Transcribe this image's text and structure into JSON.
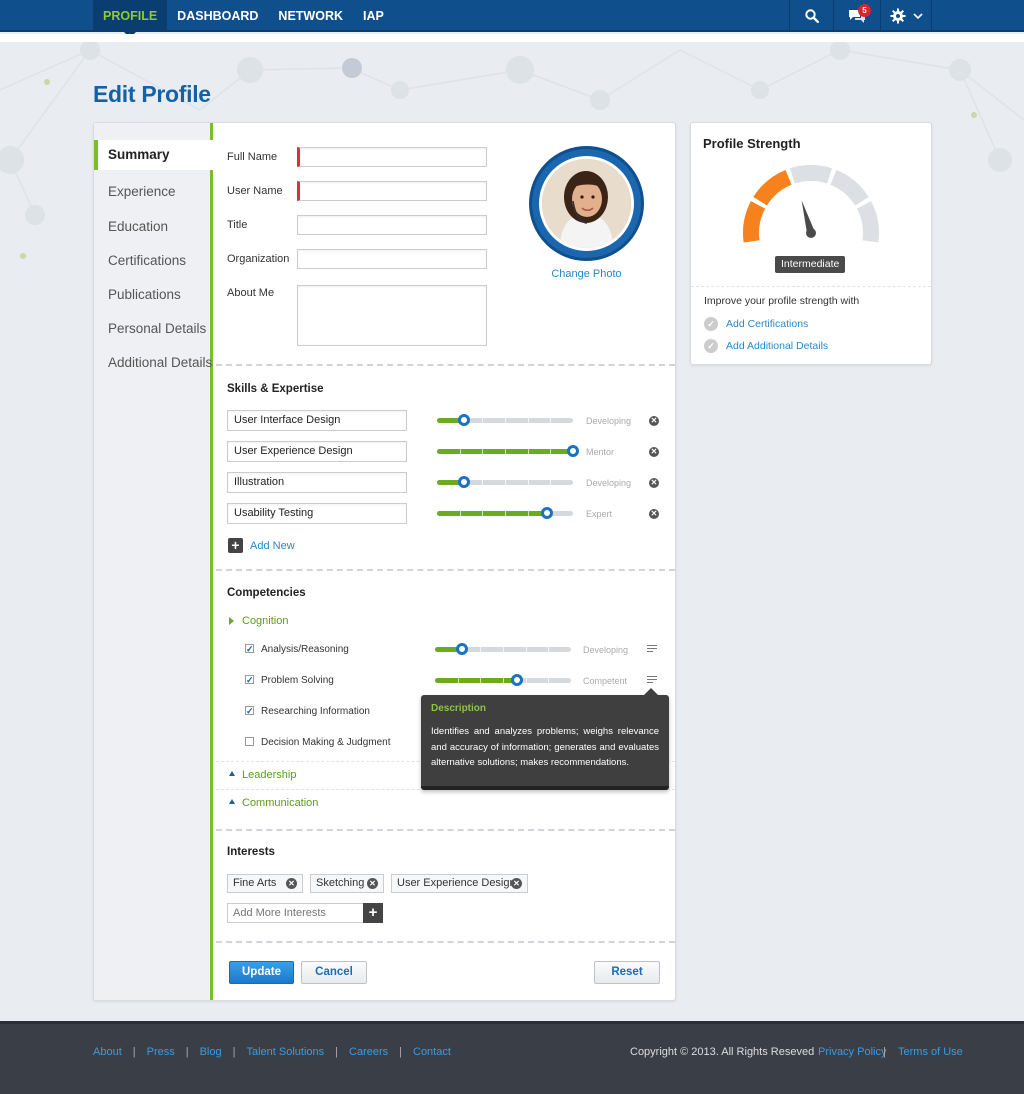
{
  "nav": {
    "items": [
      {
        "label": "PROFILE",
        "active": true
      },
      {
        "label": "DASHBOARD",
        "active": false
      },
      {
        "label": "NETWORK",
        "active": false
      },
      {
        "label": "IAP",
        "active": false
      }
    ],
    "tools": {
      "search_icon": "search-icon",
      "chat_icon": "chat-icon",
      "chat_badge": "5",
      "gear_icon": "gear-icon"
    }
  },
  "page": {
    "title": "Edit Profile"
  },
  "sidenav": {
    "items": [
      {
        "label": "Summary",
        "active": true
      },
      {
        "label": "Experience"
      },
      {
        "label": "Education"
      },
      {
        "label": "Certifications"
      },
      {
        "label": "Publications"
      },
      {
        "label": "Personal Details"
      },
      {
        "label": "Additional Details"
      }
    ]
  },
  "form": {
    "full_name_label": "Full Name",
    "user_name_label": "User Name",
    "title_label": "Title",
    "organization_label": "Organization",
    "about_label": "About Me",
    "change_photo": "Change Photo"
  },
  "skills": {
    "title": "Skills & Expertise",
    "items": [
      {
        "name": "User Interface Design",
        "level": "Developing",
        "value": 0.2
      },
      {
        "name": "User Experience Design",
        "level": "Mentor",
        "value": 1.0
      },
      {
        "name": "Illustration",
        "level": "Developing",
        "value": 0.2
      },
      {
        "name": "Usability Testing",
        "level": "Expert",
        "value": 0.81
      }
    ],
    "add_new": "Add New"
  },
  "competencies": {
    "title": "Competencies",
    "groups": [
      {
        "name": "Cognition",
        "items": [
          {
            "name": "Analysis/Reasoning",
            "checked": true,
            "level": "Developing",
            "value": 0.2
          },
          {
            "name": "Problem Solving",
            "checked": true,
            "level": "Competent",
            "value": 0.6
          },
          {
            "name": "Researching Information",
            "checked": true
          },
          {
            "name": "Decision Making & Judgment",
            "checked": false
          }
        ]
      },
      {
        "name": "Leadership"
      },
      {
        "name": "Communication"
      }
    ],
    "tooltip": {
      "title": "Description",
      "body": "Identifies and analyzes problems; weighs relevance and accuracy of information; generates and evaluates alternative solutions; makes recommendations."
    }
  },
  "interests": {
    "title": "Interests",
    "tags": [
      "Fine Arts",
      "Sketching",
      "User Experience Design"
    ],
    "add_placeholder": "Add More Interests"
  },
  "actions": {
    "update": "Update",
    "cancel": "Cancel",
    "reset": "Reset"
  },
  "profile_strength": {
    "title": "Profile Strength",
    "level": "Intermediate",
    "value": 0.42,
    "accent": "#f7811c",
    "improve_text": "Improve your profile strength with",
    "suggestions": [
      "Add Certifications",
      "Add Additional Details"
    ]
  },
  "footer": {
    "links": [
      "About",
      "Press",
      "Blog",
      "Talent Solutions",
      "Careers",
      "Contact"
    ],
    "copyright": "Copyright © 2013. All Rights Reseved",
    "privacy": "Privacy Policy",
    "terms": "Terms of Use"
  },
  "colors": {
    "primary": "#0f4f8c",
    "accent_green": "#7cbd2a",
    "link": "#2a87c8",
    "required": "#d63237"
  }
}
